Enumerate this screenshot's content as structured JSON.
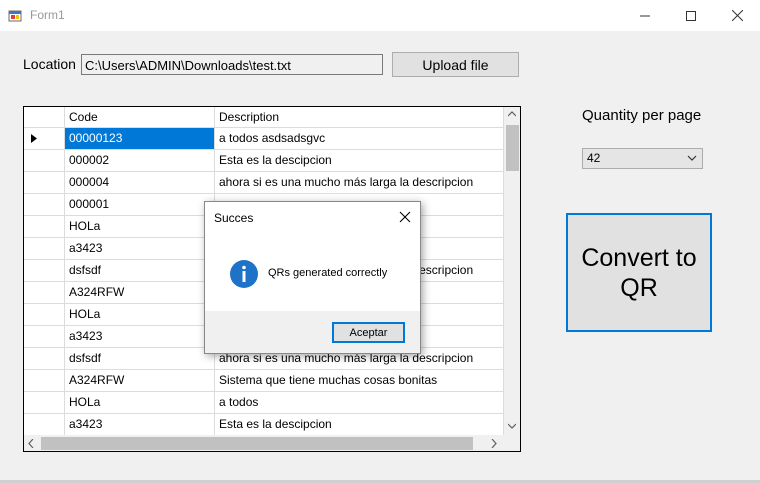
{
  "window": {
    "title": "Form1",
    "minimize_icon": "minimize-icon",
    "maximize_icon": "maximize-icon",
    "close_icon": "close-icon"
  },
  "location": {
    "label": "Location",
    "path": "C:\\Users\\ADMIN\\Downloads\\test.txt",
    "upload_label": "Upload file"
  },
  "quantity": {
    "label": "Quantity per page",
    "selected": "42"
  },
  "convert": {
    "label": "Convert to\nQR"
  },
  "grid": {
    "columns": [
      "Code",
      "Description"
    ],
    "rows": [
      {
        "code": "00000123",
        "desc": "a todos asdsadsgvc",
        "selected": true
      },
      {
        "code": "000002",
        "desc": "Esta es la descipcion"
      },
      {
        "code": "000004",
        "desc": "ahora si es una mucho más larga la descripcion"
      },
      {
        "code": "000001",
        "desc": ""
      },
      {
        "code": "HOLa",
        "desc": ""
      },
      {
        "code": "a3423",
        "desc": ""
      },
      {
        "code": "dsfsdf",
        "desc": "ahora si es una mucho más larga la descripcion"
      },
      {
        "code": "A324RFW",
        "desc": ""
      },
      {
        "code": "HOLa",
        "desc": ""
      },
      {
        "code": "a3423",
        "desc": "Esta es la descipcion"
      },
      {
        "code": "dsfsdf",
        "desc": "ahora si es una mucho más larga la descripcion"
      },
      {
        "code": "A324RFW",
        "desc": "Sistema que tiene muchas cosas bonitas"
      },
      {
        "code": "HOLa",
        "desc": "a todos"
      },
      {
        "code": "a3423",
        "desc": "Esta es la descipcion"
      }
    ]
  },
  "dialog": {
    "title": "Succes",
    "message": "QRs generated correctly",
    "ok_label": "Aceptar",
    "icon": "info-icon"
  },
  "colors": {
    "accent": "#0078d7",
    "selection": "#0078d7"
  }
}
